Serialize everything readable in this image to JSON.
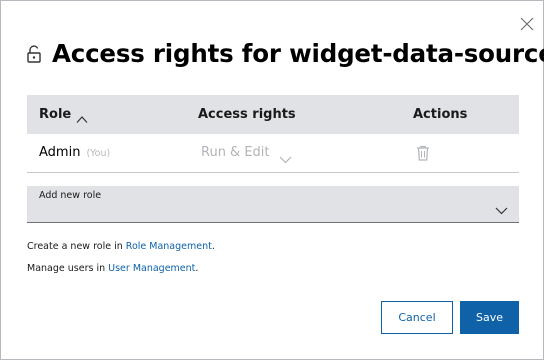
{
  "dialog": {
    "title": "Access rights for widget-data-source",
    "icons": {
      "close": "close-icon",
      "title": "unlocked-padlock-icon"
    }
  },
  "table": {
    "headers": {
      "role": "Role",
      "access_rights": "Access rights",
      "actions": "Actions"
    },
    "sort_icon": "chevron-up-icon",
    "rows": [
      {
        "role": "Admin",
        "role_note": "(You)",
        "access_rights": "Run & Edit",
        "action_icon": "trash-icon"
      }
    ]
  },
  "add_role": {
    "label": "Add new role",
    "icon": "chevron-down-icon"
  },
  "info": {
    "role_prefix": "Create a new role in ",
    "role_link": "Role Management",
    "role_suffix": ".",
    "user_prefix": "Manage users in ",
    "user_link": "User Management",
    "user_suffix": "."
  },
  "buttons": {
    "cancel": "Cancel",
    "save": "Save"
  },
  "colors": {
    "accent": "#0f62a8",
    "header_bg": "#e0e2e5",
    "muted_text": "#b1b4b8"
  }
}
